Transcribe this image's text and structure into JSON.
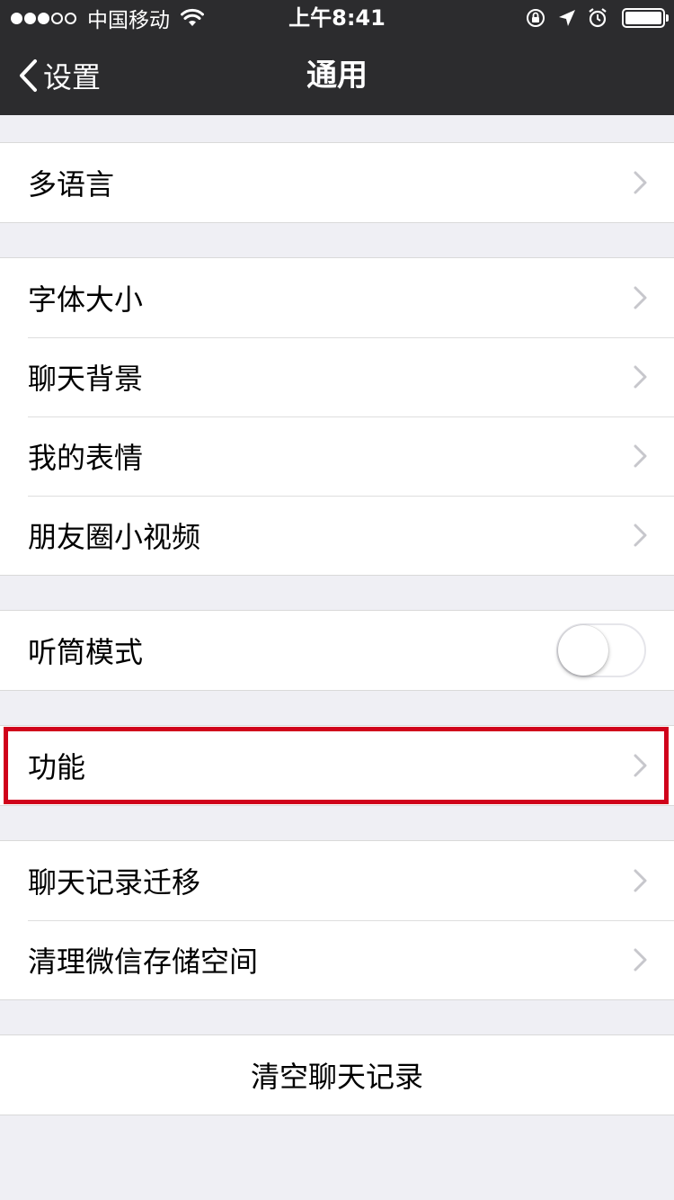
{
  "status_bar": {
    "signal_dots": [
      true,
      true,
      true,
      false,
      false
    ],
    "carrier": "中国移动",
    "time": "上午8:41",
    "icons": [
      "wifi-icon",
      "rotation-lock-icon",
      "location-arrow-icon",
      "alarm-icon",
      "battery-icon"
    ],
    "battery_level": 1.0
  },
  "nav": {
    "back_label": "设置",
    "title": "通用"
  },
  "groups": {
    "language": {
      "items": [
        {
          "label": "多语言"
        }
      ]
    },
    "display": {
      "items": [
        {
          "label": "字体大小"
        },
        {
          "label": "聊天背景"
        },
        {
          "label": "我的表情"
        },
        {
          "label": "朋友圈小视频"
        }
      ]
    },
    "earpiece": {
      "label": "听筒模式",
      "toggle_on": false
    },
    "features": {
      "label": "功能"
    },
    "storage": {
      "items": [
        {
          "label": "聊天记录迁移"
        },
        {
          "label": "清理微信存储空间"
        }
      ]
    },
    "clear": {
      "label": "清空聊天记录"
    }
  },
  "colors": {
    "nav_background": "#2c2c2e",
    "page_background": "#efeff4",
    "highlight": "#d0021b",
    "chevron": "#c7c7cc"
  }
}
